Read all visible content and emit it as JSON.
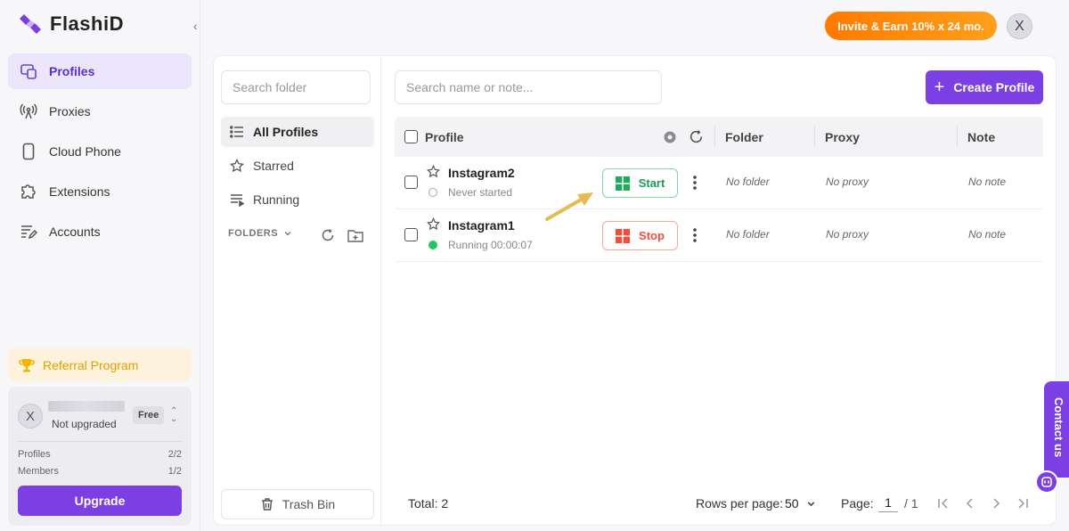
{
  "brand": {
    "name": "FlashiD",
    "accent": "#7b3fe4"
  },
  "sidebar": {
    "items": [
      {
        "label": "Profiles",
        "icon": "profiles-icon",
        "active": true
      },
      {
        "label": "Proxies",
        "icon": "antenna-icon",
        "active": false
      },
      {
        "label": "Cloud Phone",
        "icon": "phone-icon",
        "active": false
      },
      {
        "label": "Extensions",
        "icon": "puzzle-icon",
        "active": false
      },
      {
        "label": "Accounts",
        "icon": "accounts-icon",
        "active": false
      }
    ],
    "referral": {
      "label": "Referral Program",
      "icon": "trophy-icon"
    },
    "account": {
      "avatar": "X",
      "status": "Not upgraded",
      "plan": "Free",
      "stats": [
        {
          "label": "Profiles",
          "value": "2/2"
        },
        {
          "label": "Members",
          "value": "1/2"
        }
      ],
      "upgrade_label": "Upgrade"
    }
  },
  "topbar": {
    "invite_label": "Invite & Earn 10% x 24 mo.",
    "avatar": "X"
  },
  "folders": {
    "search_placeholder": "Search folder",
    "items": [
      {
        "label": "All Profiles",
        "icon": "list-icon",
        "active": true
      },
      {
        "label": "Starred",
        "icon": "starred-icon",
        "active": false
      },
      {
        "label": "Running",
        "icon": "running-icon",
        "active": false
      }
    ],
    "header": "FOLDERS",
    "trash_label": "Trash Bin"
  },
  "profiles": {
    "search_placeholder": "Search name or note...",
    "create_label": "Create Profile",
    "columns": {
      "profile": "Profile",
      "folder": "Folder",
      "proxy": "Proxy",
      "note": "Note"
    },
    "rows": [
      {
        "name": "Instagram2",
        "status": "Never started",
        "running": false,
        "action": "Start",
        "folder": "No folder",
        "proxy": "No proxy",
        "note": "No note"
      },
      {
        "name": "Instagram1",
        "status": "Running 00:00:07",
        "running": true,
        "action": "Stop",
        "folder": "No folder",
        "proxy": "No proxy",
        "note": "No note"
      }
    ]
  },
  "footer": {
    "total": "Total: 2",
    "rows_label": "Rows per page:",
    "rows_value": "50",
    "page_label": "Page:",
    "page_current": "1",
    "page_total": "/ 1"
  },
  "contact": {
    "label": "Contact us"
  }
}
